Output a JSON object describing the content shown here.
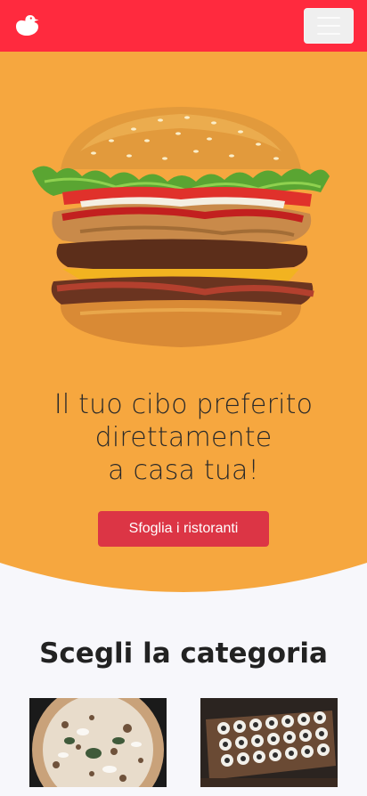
{
  "navbar": {
    "logo_icon": "duck-logo-icon",
    "menu_icon": "hamburger-menu-icon",
    "background": "#ff2a3e"
  },
  "hero": {
    "title_line1": "Il tuo cibo preferito",
    "title_line2": "direttamente",
    "title_line3": "a casa tua!",
    "cta_label": "Sfoglia i ristoranti",
    "background": "#f6a73f",
    "image": "burger-image"
  },
  "categories": {
    "title": "Scegli la categoria",
    "items": [
      {
        "image": "pizza-image"
      },
      {
        "image": "sushi-image"
      }
    ]
  }
}
